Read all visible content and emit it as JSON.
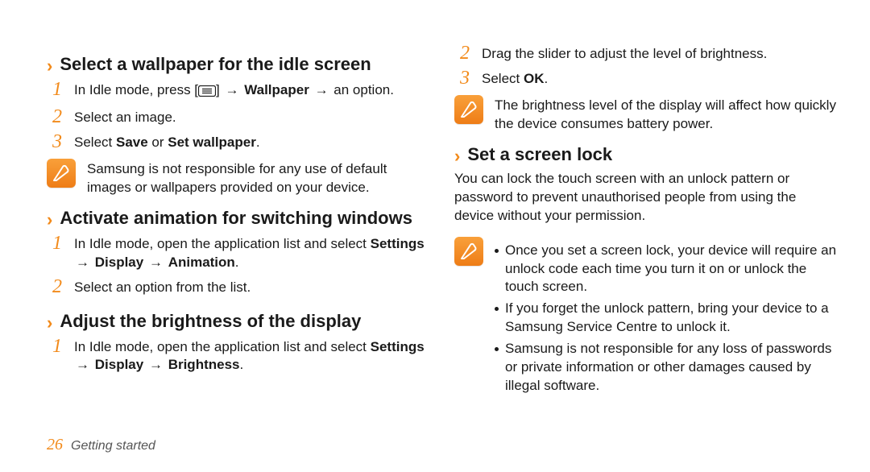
{
  "left": {
    "wallpaper": {
      "title": "Select a wallpaper for the idle screen",
      "step1_a": "In Idle mode, press [",
      "step1_b": "] ",
      "step1_wp": "Wallpaper",
      "step1_c": " an option.",
      "step2": "Select an image.",
      "step3_a": "Select ",
      "step3_save": "Save",
      "step3_or": " or ",
      "step3_sw": "Set wallpaper",
      "step3_dot": ".",
      "note": "Samsung is not responsible for any use of default images or wallpapers provided on your device."
    },
    "animation": {
      "title": "Activate animation for switching windows",
      "step1_a": "In Idle mode, open the application list and select ",
      "step1_path_1": "Settings",
      "step1_path_2": "Display",
      "step1_path_3": "Animation",
      "step1_dot": ".",
      "step2": "Select an option from the list."
    },
    "brightness": {
      "title": "Adjust the brightness of the display",
      "step1_a": "In Idle mode, open the application list and select ",
      "step1_path_1": "Settings",
      "step1_path_2": "Display",
      "step1_path_3": "Brightness",
      "step1_dot": "."
    }
  },
  "right": {
    "brightness_cont": {
      "step2": "Drag the slider to adjust the level of brightness.",
      "step3_a": "Select ",
      "step3_ok": "OK",
      "step3_dot": ".",
      "note": "The brightness level of the display will affect how quickly the device consumes battery power."
    },
    "screenlock": {
      "title": "Set a screen lock",
      "para": "You can lock the touch screen with an unlock pattern or password to prevent unauthorised people from using the device without your permission.",
      "bullets": [
        "Once you set a screen lock, your device will require an unlock code each time you turn it on or unlock the touch screen.",
        "If you forget the unlock pattern, bring your device to a Samsung Service Centre to unlock it.",
        "Samsung is not responsible for any loss of passwords or private information or other damages caused by illegal software."
      ]
    }
  },
  "footer": {
    "page": "26",
    "label": "Getting started"
  },
  "arrow": "→"
}
